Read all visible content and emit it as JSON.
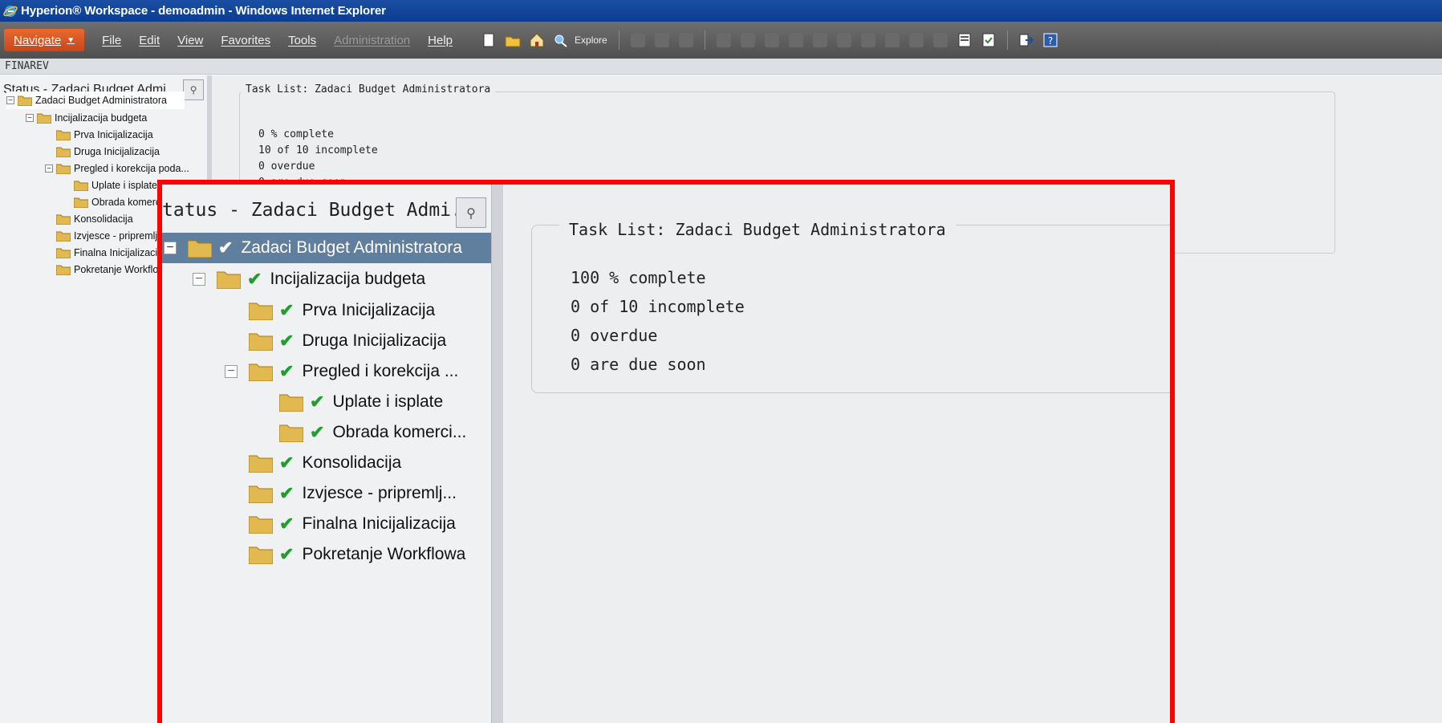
{
  "window": {
    "title": "Hyperion® Workspace - demoadmin - Windows Internet Explorer"
  },
  "menubar": {
    "navigate_label": "Navigate",
    "items": [
      {
        "label": "File",
        "enabled": true
      },
      {
        "label": "Edit",
        "enabled": true
      },
      {
        "label": "View",
        "enabled": true
      },
      {
        "label": "Favorites",
        "enabled": true
      },
      {
        "label": "Tools",
        "enabled": true
      },
      {
        "label": "Administration",
        "enabled": false
      },
      {
        "label": "Help",
        "enabled": true
      }
    ],
    "explore_label": "Explore"
  },
  "subbar": {
    "label": "FINAREV"
  },
  "background": {
    "panel_header": "Status - Zadaci Budget Admi...",
    "tree": [
      "Zadaci Budget Administratora",
      "Incijalizacija budgeta",
      "Prva Inicijalizacija",
      "Druga Inicijalizacija",
      "Pregled i korekcija poda...",
      "Uplate i isplate",
      "Obrada komercij",
      "Konsolidacija",
      "Izvjesce - pripremlje",
      "Finalna Inicijalizacija",
      "Pokretanje Workflow"
    ],
    "task_list_title": "Task List: Zadaci Budget Administratora",
    "stats": [
      "0 % complete",
      "10  of  10  incomplete",
      "0  overdue",
      "0  are due soon"
    ]
  },
  "inset": {
    "panel_header": "tatus - Zadaci Budget Admi...",
    "tree": [
      "Zadaci Budget Administratora",
      "Incijalizacija budgeta",
      "Prva Inicijalizacija",
      "Druga Inicijalizacija",
      "Pregled i korekcija ...",
      "Uplate i isplate",
      "Obrada komerci...",
      "Konsolidacija",
      "Izvjesce - pripremlj...",
      "Finalna Inicijalizacija",
      "Pokretanje Workflowa"
    ],
    "task_list_title": "Task List: Zadaci Budget Administratora",
    "stats": [
      "100 % complete",
      "0  of  10  incomplete",
      "0  overdue",
      "0  are due soon"
    ]
  },
  "colors": {
    "accent": "#ff0000",
    "selected": "#607e9e",
    "check": "#1e9f2e",
    "navigate": "#d9541f"
  }
}
